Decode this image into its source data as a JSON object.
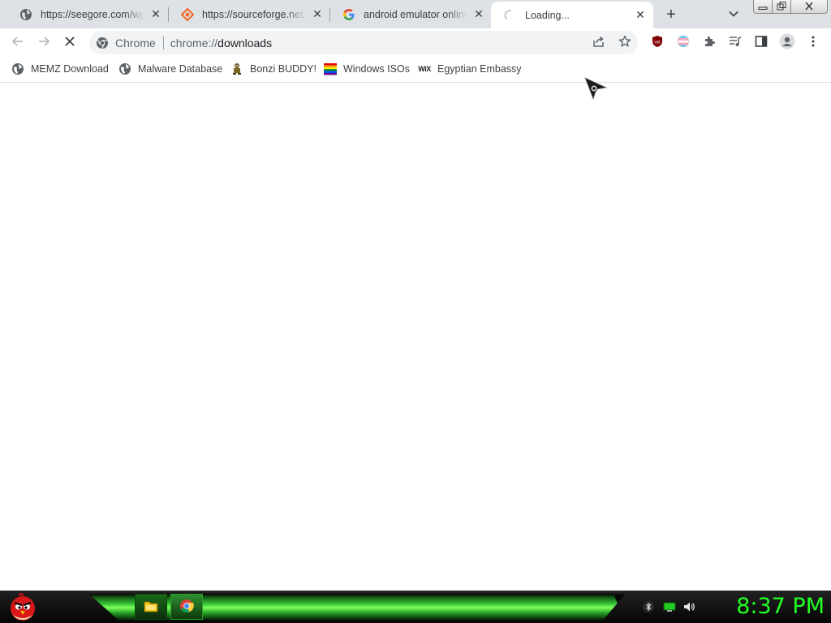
{
  "tabs": [
    {
      "title": "https://seegore.com/wp-",
      "favicon": "globe-icon",
      "active": false
    },
    {
      "title": "https://sourceforge.net/p",
      "favicon": "sourceforge-icon",
      "active": false
    },
    {
      "title": "android emulator online",
      "favicon": "google-icon",
      "active": false
    },
    {
      "title": "Loading...",
      "favicon": "loading-spinner-icon",
      "active": true
    }
  ],
  "tab_close_glyph": "✕",
  "new_tab_glyph": "+",
  "toolbar": {
    "back_icon": "arrow-left-icon",
    "forward_icon": "arrow-right-icon",
    "stop_icon": "stop-icon"
  },
  "omnibox": {
    "chip_label": "Chrome",
    "url_scheme": "chrome://",
    "url_host": "downloads"
  },
  "extensions": [
    "ublock-origin-icon",
    "flag-extension-icon",
    "puzzle-icon",
    "media-control-icon",
    "side-panel-icon",
    "profile-icon",
    "kebab-menu-icon"
  ],
  "bookmarks": [
    {
      "label": "MEMZ Download",
      "icon": "globe-icon"
    },
    {
      "label": "Malware Database",
      "icon": "globe-icon"
    },
    {
      "label": "Bonzi BUDDY!",
      "icon": "bonzi-icon"
    },
    {
      "label": "Windows ISOs",
      "icon": "rainbow-icon"
    },
    {
      "label": "Egyptian Embassy",
      "icon": "wix-icon"
    }
  ],
  "wix_text": "WiX",
  "taskbar": {
    "start_icon": "angry-bird-icon",
    "tasks": [
      "file-explorer-icon",
      "chrome-icon"
    ],
    "tray": [
      "bluetooth-icon",
      "battery-icon",
      "volume-icon"
    ],
    "clock": "8:37 PM"
  },
  "colors": {
    "tab_strip": "#dee1e6",
    "clock": "#22ff22",
    "taskbar_glow": "#36c436"
  }
}
